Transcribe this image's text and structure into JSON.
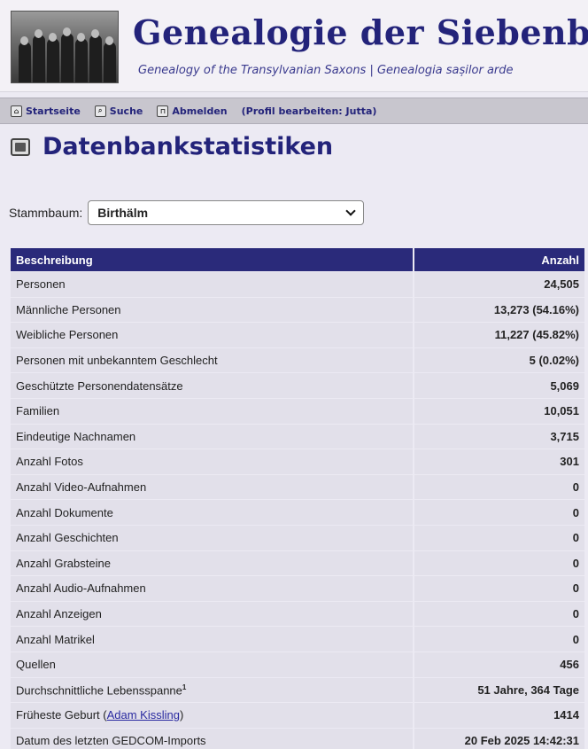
{
  "header": {
    "title": "Genealogie der Siebenbü",
    "subtitle": "Genealogy of the Transylvanian Saxons | Genealogia sașilor arde"
  },
  "nav": {
    "items": [
      {
        "label": "Startseite",
        "icon": "home-icon"
      },
      {
        "label": "Suche",
        "icon": "search-icon"
      },
      {
        "label": "Abmelden",
        "icon": "lock-icon"
      },
      {
        "label": "(Profil bearbeiten: Jutta)",
        "icon": ""
      }
    ]
  },
  "page": {
    "title": "Datenbankstatistiken",
    "tree_label": "Stammbaum:",
    "tree_selected": "Birthälm"
  },
  "table": {
    "headers": [
      "Beschreibung",
      "Anzahl"
    ],
    "rows": [
      {
        "label": "Personen",
        "value": "24,505"
      },
      {
        "label": "Männliche Personen",
        "value": "13,273 (54.16%)"
      },
      {
        "label": "Weibliche Personen",
        "value": "11,227 (45.82%)"
      },
      {
        "label": "Personen mit unbekanntem Geschlecht",
        "value": "5 (0.02%)"
      },
      {
        "label": "Geschützte Personendatensätze",
        "value": "5,069"
      },
      {
        "label": "Familien",
        "value": "10,051"
      },
      {
        "label": "Eindeutige Nachnamen",
        "value": "3,715"
      },
      {
        "label": "Anzahl Fotos",
        "value": "301"
      },
      {
        "label": "Anzahl Video-Aufnahmen",
        "value": "0"
      },
      {
        "label": "Anzahl Dokumente",
        "value": "0"
      },
      {
        "label": "Anzahl Geschichten",
        "value": "0"
      },
      {
        "label": "Anzahl Grabsteine",
        "value": "0"
      },
      {
        "label": "Anzahl Audio-Aufnahmen",
        "value": "0"
      },
      {
        "label": "Anzahl Anzeigen",
        "value": "0"
      },
      {
        "label": "Anzahl Matrikel",
        "value": "0"
      },
      {
        "label": "Quellen",
        "value": "456"
      },
      {
        "label": "Durchschnittliche Lebensspanne",
        "sup": "1",
        "value": "51 Jahre, 364 Tage"
      },
      {
        "label": "Früheste Geburt",
        "link": "Adam Kissling",
        "value": "1414"
      },
      {
        "label": "Datum des letzten GEDCOM-Imports",
        "value": "20 Feb 2025 14:42:31"
      }
    ]
  }
}
